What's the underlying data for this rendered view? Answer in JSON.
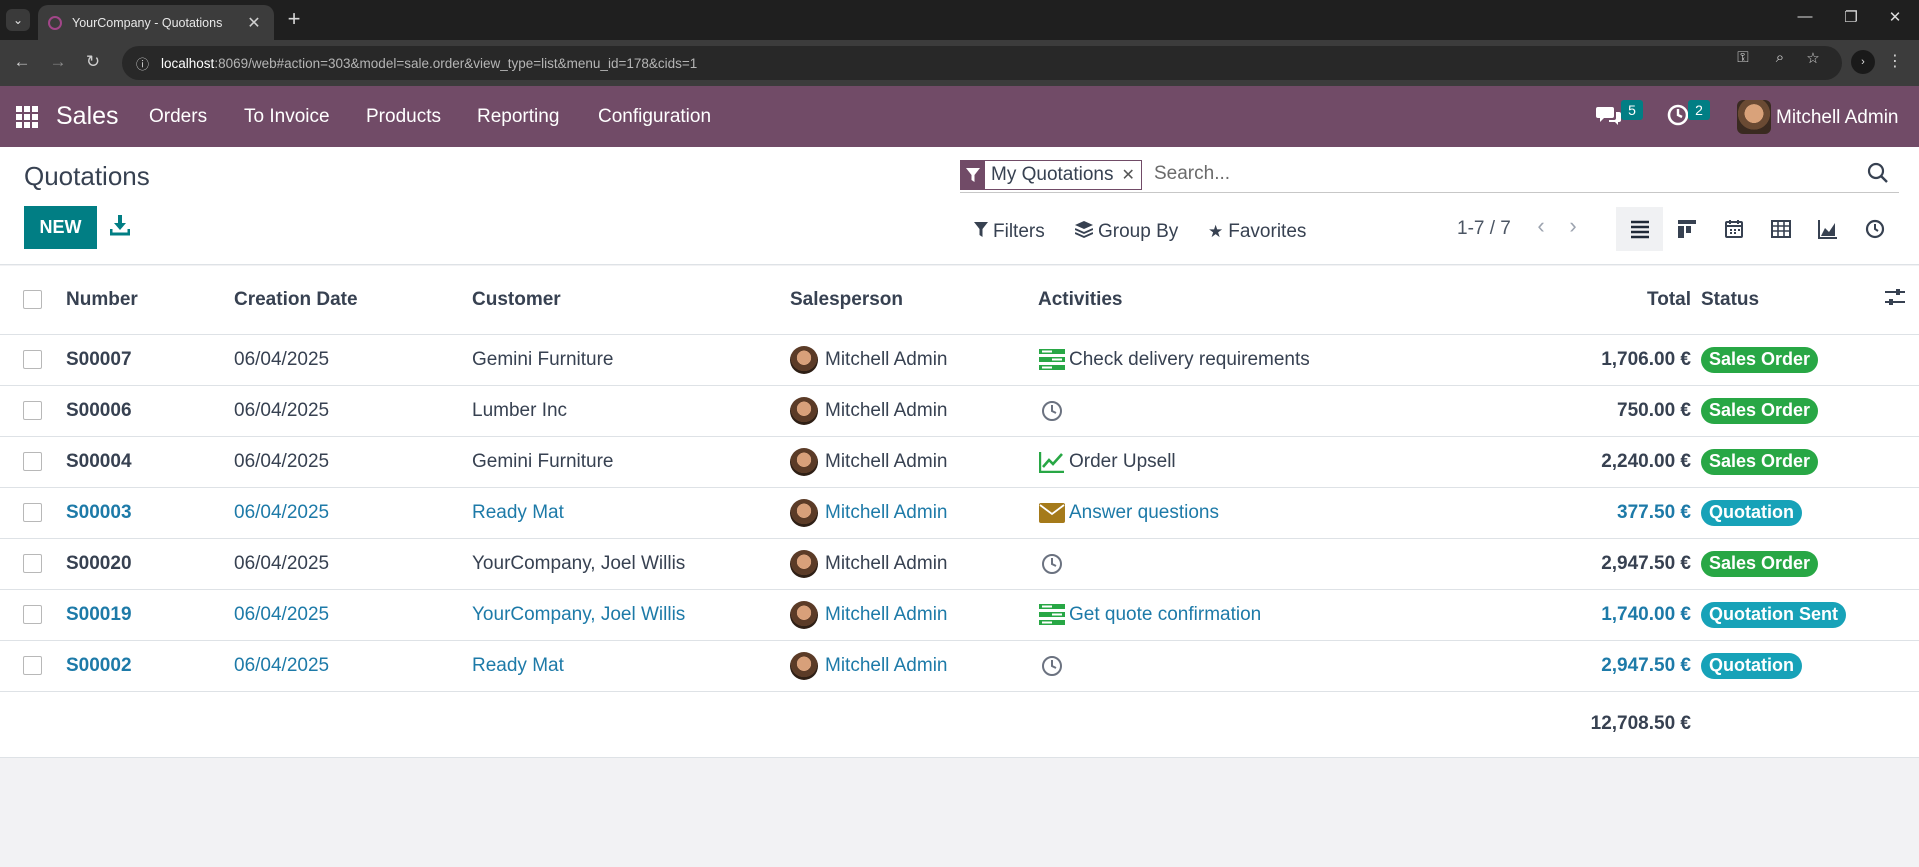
{
  "browser": {
    "tab_title": "YourCompany - Quotations",
    "url_host": "localhost",
    "url_rest": ":8069/web#action=303&model=sale.order&view_type=list&menu_id=178&cids=1"
  },
  "navbar": {
    "app_name": "Sales",
    "menu": [
      "Orders",
      "To Invoice",
      "Products",
      "Reporting",
      "Configuration"
    ],
    "messages_count": "5",
    "activities_count": "2",
    "user_name": "Mitchell Admin"
  },
  "control_panel": {
    "title": "Quotations",
    "new_label": "NEW",
    "facet_label": "My Quotations",
    "search_placeholder": "Search...",
    "filters_label": "Filters",
    "groupby_label": "Group By",
    "favorites_label": "Favorites",
    "pager": "1-7 / 7"
  },
  "list": {
    "headers": {
      "number": "Number",
      "creation_date": "Creation Date",
      "customer": "Customer",
      "salesperson": "Salesperson",
      "activities": "Activities",
      "total": "Total",
      "status": "Status"
    },
    "rows": [
      {
        "number": "S00007",
        "date": "06/04/2025",
        "customer": "Gemini Furniture",
        "salesperson": "Mitchell Admin",
        "activity_icon": "call-todo-icon",
        "activity": "Check delivery requirements",
        "total": "1,706.00 €",
        "status": "Sales Order",
        "type": "order"
      },
      {
        "number": "S00006",
        "date": "06/04/2025",
        "customer": "Lumber Inc",
        "salesperson": "Mitchell Admin",
        "activity_icon": "clock-icon",
        "activity": "",
        "total": "750.00 €",
        "status": "Sales Order",
        "type": "order"
      },
      {
        "number": "S00004",
        "date": "06/04/2025",
        "customer": "Gemini Furniture",
        "salesperson": "Mitchell Admin",
        "activity_icon": "upsell-chart-icon",
        "activity": "Order Upsell",
        "total": "2,240.00 €",
        "status": "Sales Order",
        "type": "order"
      },
      {
        "number": "S00003",
        "date": "06/04/2025",
        "customer": "Ready Mat",
        "salesperson": "Mitchell Admin",
        "activity_icon": "envelope-icon",
        "activity": "Answer questions",
        "total": "377.50 €",
        "status": "Quotation",
        "type": "quote"
      },
      {
        "number": "S00020",
        "date": "06/04/2025",
        "customer": "YourCompany, Joel Willis",
        "salesperson": "Mitchell Admin",
        "activity_icon": "clock-icon",
        "activity": "",
        "total": "2,947.50 €",
        "status": "Sales Order",
        "type": "order"
      },
      {
        "number": "S00019",
        "date": "06/04/2025",
        "customer": "YourCompany, Joel Willis",
        "salesperson": "Mitchell Admin",
        "activity_icon": "call-todo-icon",
        "activity": "Get quote confirmation",
        "total": "1,740.00 €",
        "status": "Quotation Sent",
        "type": "quote"
      },
      {
        "number": "S00002",
        "date": "06/04/2025",
        "customer": "Ready Mat",
        "salesperson": "Mitchell Admin",
        "activity_icon": "clock-icon",
        "activity": "",
        "total": "2,947.50 €",
        "status": "Quotation",
        "type": "quote"
      }
    ],
    "sum_total": "12,708.50 €"
  },
  "colors": {
    "brand": "#714b67",
    "primary": "#017e84",
    "sales_order_badge": "#28a745",
    "quotation_badge": "#17a2b8",
    "link": "#1d7aa8"
  }
}
